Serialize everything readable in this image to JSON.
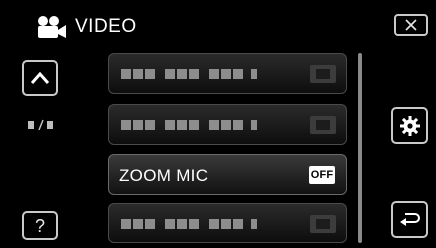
{
  "header": {
    "title": "VIDEO",
    "mode_icon": "video-camera-icon"
  },
  "nav": {
    "up_icon": "chevron-up-icon",
    "help_label": "?",
    "close_icon": "close-x-icon",
    "settings_icon": "gear-icon",
    "back_icon": "return-arrow-icon"
  },
  "page_indicator": {
    "current": 1,
    "total": 1
  },
  "menu": {
    "items": [
      {
        "label": "",
        "value": ""
      },
      {
        "label": "",
        "value": ""
      },
      {
        "label": "ZOOM MIC",
        "value": "OFF"
      },
      {
        "label": "",
        "value": ""
      }
    ]
  },
  "colors": {
    "background": "#000000",
    "text": "#ffffff",
    "border": "#c9c9c9",
    "badge": "#ffffff"
  }
}
